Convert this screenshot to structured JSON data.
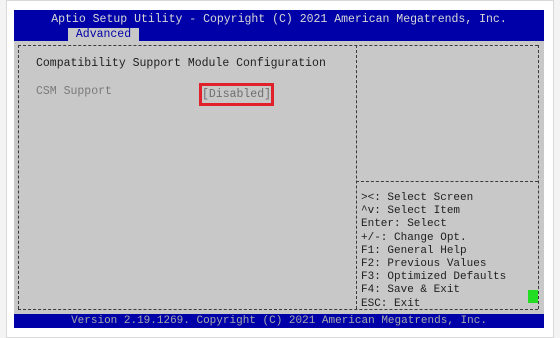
{
  "header": {
    "title": "Aptio Setup Utility - Copyright (C) 2021 American Megatrends, Inc.",
    "active_tab": "Advanced"
  },
  "main": {
    "page_title": "Compatibility Support Module Configuration",
    "settings": [
      {
        "label": "CSM Support",
        "value": "[Disabled]"
      }
    ]
  },
  "help": {
    "items": [
      "><: Select Screen",
      "^v: Select Item",
      "Enter: Select",
      "+/-: Change Opt.",
      "F1: General Help",
      "F2: Previous Values",
      "F3: Optimized Defaults",
      "F4: Save & Exit",
      "ESC: Exit"
    ]
  },
  "footer": {
    "version": "Version 2.19.1269. Copyright (C) 2021 American Megatrends, Inc."
  },
  "colors": {
    "bios_blue": "#0000a8",
    "panel_gray": "#c8c8c8",
    "highlight_red": "#e0202a",
    "indicator_green": "#22dd22"
  }
}
